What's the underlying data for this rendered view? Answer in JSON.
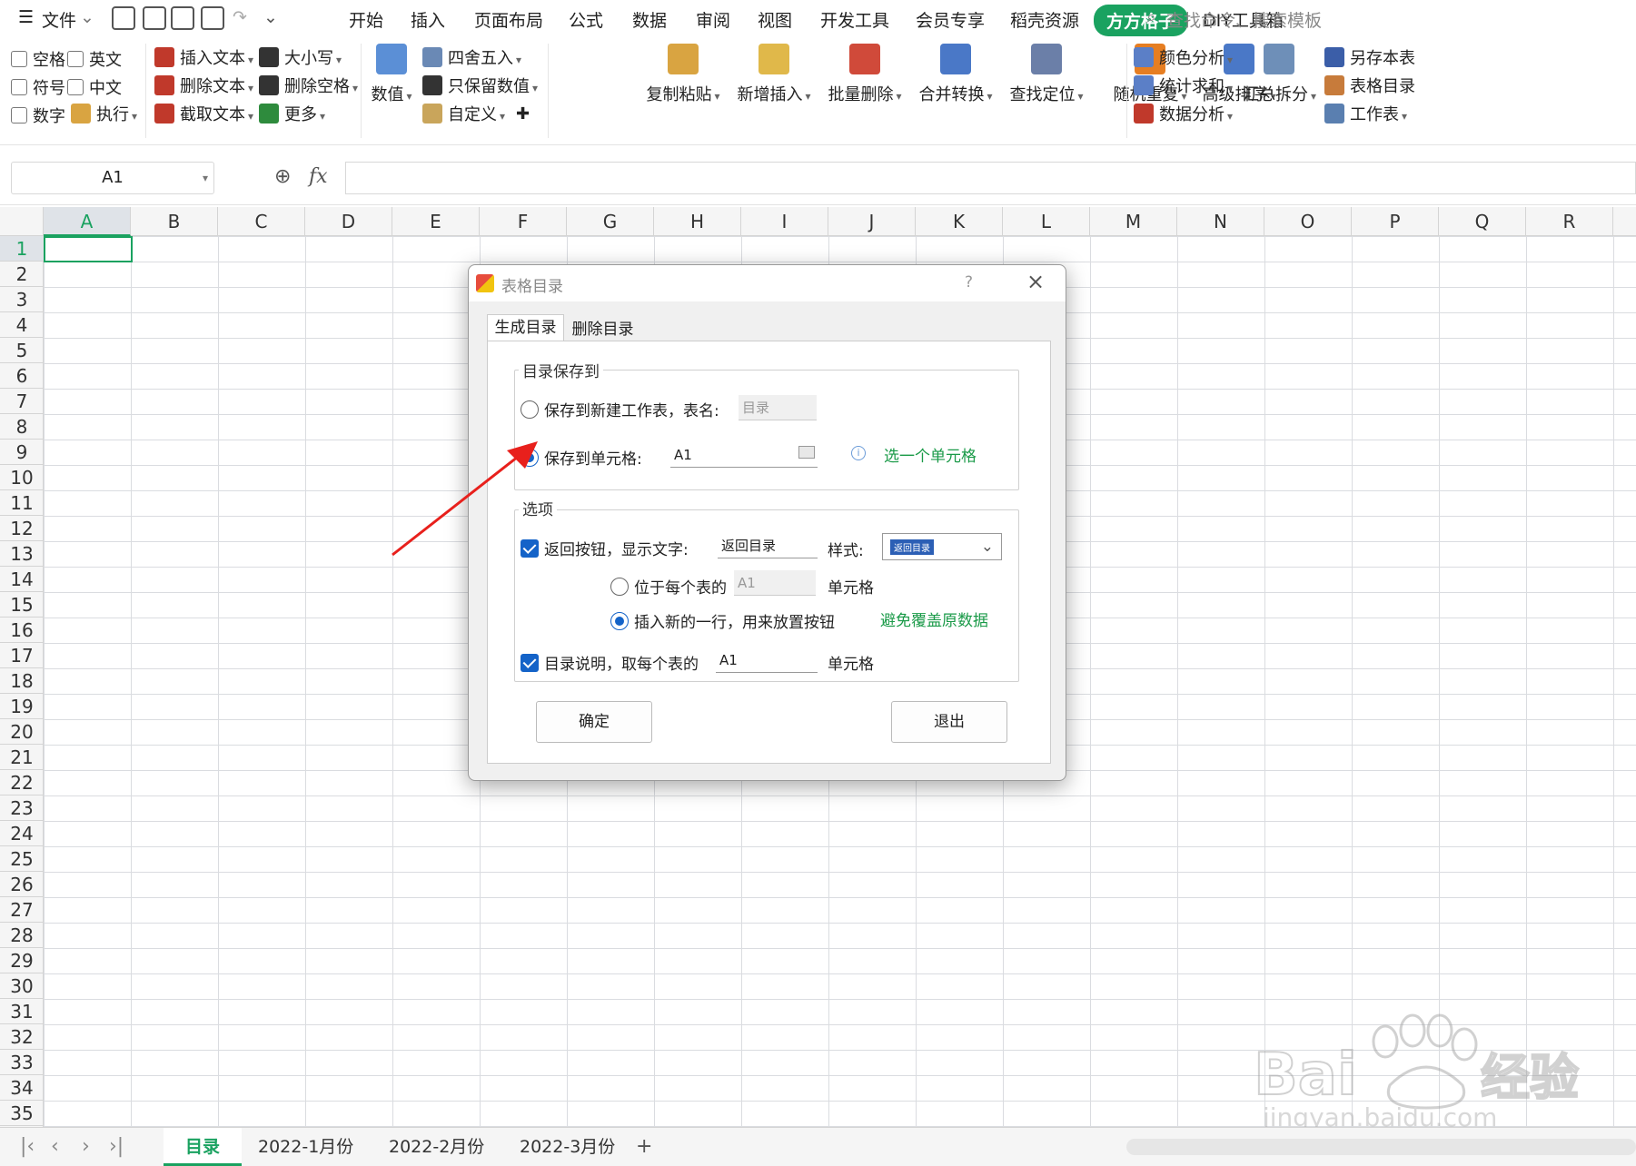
{
  "menubar": {
    "file": "文件",
    "tabs": [
      "开始",
      "插入",
      "页面布局",
      "公式",
      "数据",
      "审阅",
      "视图",
      "开发工具",
      "会员专享",
      "稻壳资源",
      "方方格子",
      "DIY工具箱"
    ],
    "search_placeholder": "查找命令、搜索模板"
  },
  "ribbon": {
    "checkboxes": [
      "空格",
      "英文",
      "符号",
      "中文",
      "数字"
    ],
    "execute": "执行",
    "text_group": [
      "插入文本",
      "删除文本",
      "截取文本"
    ],
    "case_group": [
      "大小写",
      "删除空格",
      "更多"
    ],
    "numeric": "数值",
    "round_group": [
      "四舍五入",
      "只保留数值",
      "自定义"
    ],
    "big_buttons": [
      "复制粘贴",
      "新增插入",
      "批量删除",
      "合并转换",
      "查找定位",
      "随机重复",
      "高级排序"
    ],
    "analysis_group": [
      "颜色分析",
      "统计求和",
      "数据分析"
    ],
    "summary_split": "汇总拆分",
    "sheet_group": [
      "另存本表",
      "表格目录",
      "工作表"
    ]
  },
  "formula_bar": {
    "name_box": "A1",
    "fx": "fx"
  },
  "columns": [
    "A",
    "B",
    "C",
    "D",
    "E",
    "F",
    "G",
    "H",
    "I",
    "J",
    "K",
    "L",
    "M",
    "N",
    "O",
    "P",
    "Q",
    "R"
  ],
  "rows": [
    "1",
    "2",
    "3",
    "4",
    "5",
    "6",
    "7",
    "8",
    "9",
    "10",
    "11",
    "12",
    "13",
    "14",
    "15",
    "16",
    "17",
    "18",
    "19",
    "20",
    "21",
    "22",
    "23",
    "24",
    "25",
    "26",
    "27",
    "28",
    "29",
    "30",
    "31",
    "32",
    "33",
    "34",
    "35"
  ],
  "sheet_tabs": [
    "目录",
    "2022-1月份",
    "2022-2月份",
    "2022-3月份"
  ],
  "dialog": {
    "title": "表格目录",
    "help": "?",
    "tabs": [
      "生成目录",
      "删除目录"
    ],
    "save_group": "目录保存到",
    "save_new_sheet": "保存到新建工作表，表名:",
    "new_sheet_name": "目录",
    "save_to_cell": "保存到单元格:",
    "cell_value": "A1",
    "select_cell_hint": "选一个单元格",
    "options_group": "选项",
    "back_button_label": "返回按钮，显示文字:",
    "back_button_text": "返回目录",
    "style_label": "样式:",
    "style_value": "返回目录",
    "position_each_sheet": "位于每个表的",
    "position_cell": "A1",
    "cell_suffix": "单元格",
    "insert_new_row": "插入新的一行，用来放置按钮",
    "avoid_overwrite": "避免覆盖原数据",
    "desc_label": "目录说明，取每个表的",
    "desc_cell": "A1",
    "desc_suffix": "单元格",
    "ok": "确定",
    "exit": "退出"
  },
  "colors": {
    "accent": "#1aa260",
    "radio_blue": "#1463c8",
    "arrow": "#e8201c"
  },
  "watermark": {
    "brand": "Bai",
    "cn": "经验",
    "url": "jingyan.baidu.com"
  }
}
